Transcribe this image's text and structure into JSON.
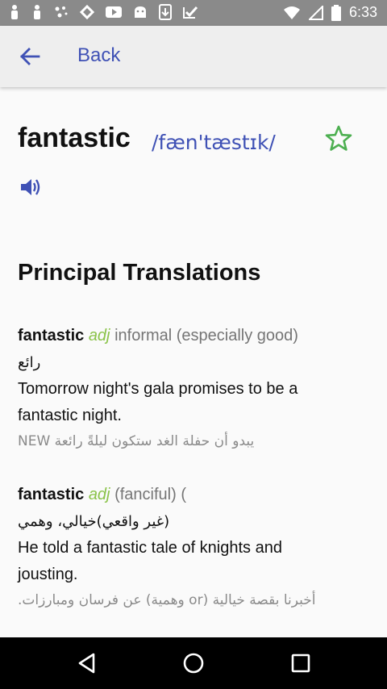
{
  "status_bar": {
    "time": "6:33",
    "icons": [
      "person-icon",
      "person-icon",
      "dots-icon",
      "sync-icon",
      "video-icon",
      "android-icon",
      "download-icon",
      "check-icon",
      "wifi-icon",
      "signal-icon",
      "battery-icon"
    ]
  },
  "app_bar": {
    "back_label": "Back"
  },
  "entry": {
    "headword": "fantastic",
    "pronunciation": "/fæn'tæstɪk/",
    "favorite_icon": "star-outline-icon",
    "audio_icon": "speaker-icon",
    "accent_color": "#3f51b5",
    "pos_color": "#8bc34a"
  },
  "section": {
    "title": "Principal Translations"
  },
  "translations": [
    {
      "word": "fantastic",
      "pos": "adj",
      "note": "informal (especially good)",
      "arabic": "رائع",
      "example_en": "Tomorrow night's gala promises to be a fantastic night.",
      "example_ar": "يبدو أن حفلة الغد ستكون ليلةً رائعة NEW"
    },
    {
      "word": "fantastic",
      "pos": "adj",
      "note": "(fanciful) (",
      "arabic": "(غير واقعي)خيالي، وهمي",
      "example_en": "He told a fantastic tale of knights and jousting.",
      "example_ar": "أخبرنا بقصة خيالية (or وهمية) عن فرسان ومبارزات."
    }
  ],
  "nav_bar": {
    "buttons": [
      "back-triangle-icon",
      "home-circle-icon",
      "recents-square-icon"
    ]
  }
}
